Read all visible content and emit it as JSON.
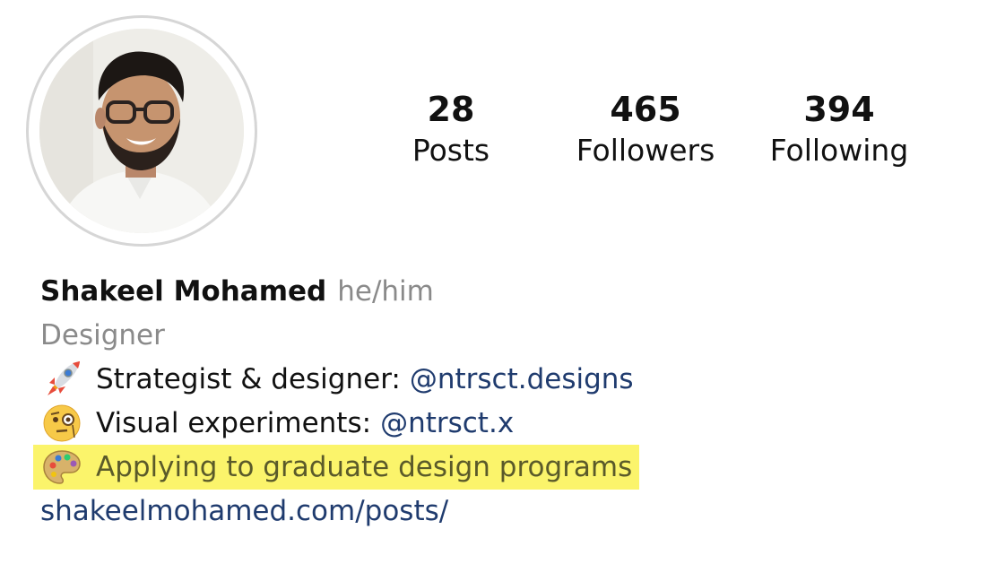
{
  "profile": {
    "avatar_alt": "Profile photo",
    "name": "Shakeel Mohamed",
    "pronouns": "he/him",
    "category": "Designer"
  },
  "stats": {
    "posts": {
      "count": "28",
      "label": "Posts"
    },
    "followers": {
      "count": "465",
      "label": "Followers"
    },
    "following": {
      "count": "394",
      "label": "Following"
    }
  },
  "bio": {
    "line1": {
      "icon": "rocket-icon",
      "text": "Strategist & designer:",
      "mention": "@ntrsct.designs"
    },
    "line2": {
      "icon": "monocle-face-icon",
      "text": "Visual experiments:",
      "mention": "@ntrsct.x"
    },
    "line3": {
      "icon": "palette-icon",
      "text": "Applying to graduate design programs",
      "highlight_color": "#fbf46b"
    },
    "website": "shakeelmohamed.com/posts/"
  },
  "colors": {
    "link": "#1f3b6e",
    "secondary_text": "#8a8a8a",
    "highlight": "#fbf46b"
  }
}
